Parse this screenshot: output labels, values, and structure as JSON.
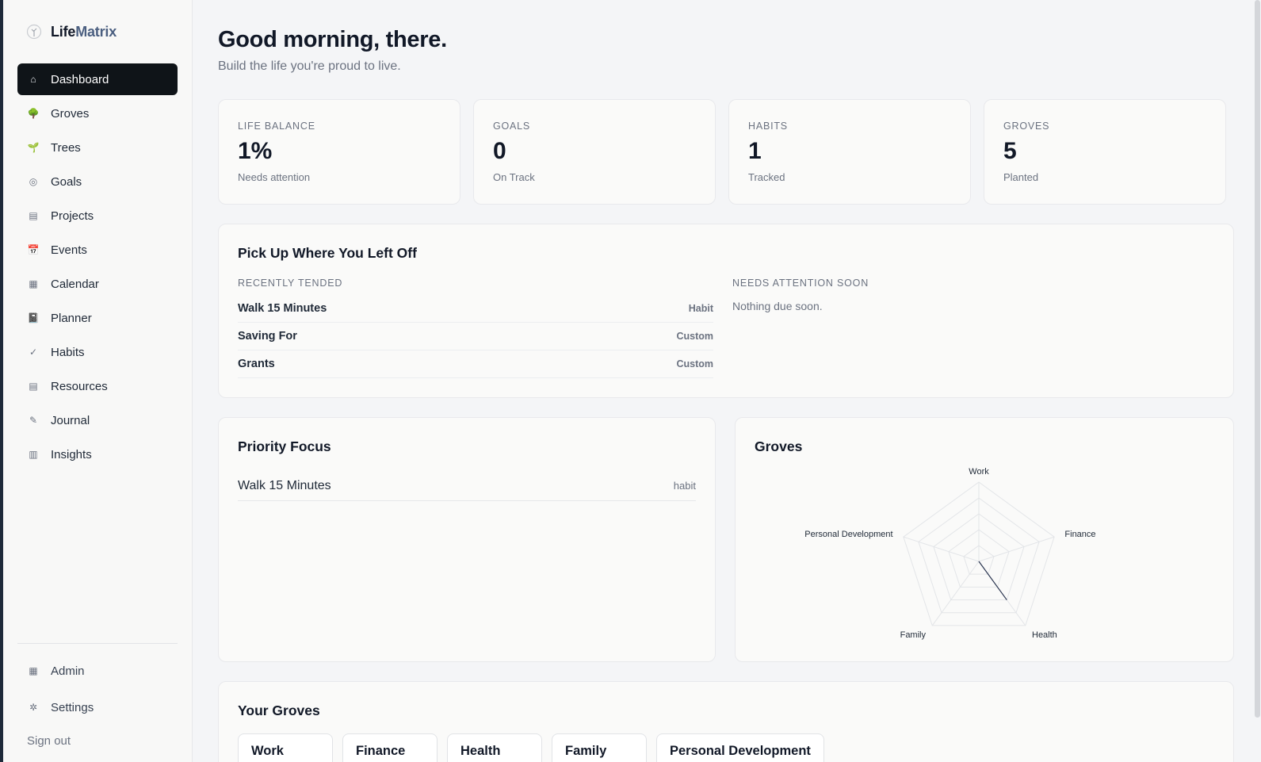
{
  "brand": {
    "part1": "Life",
    "part2": "Matrix"
  },
  "nav": [
    {
      "label": "Dashboard",
      "icon": "⌂",
      "name": "home-icon"
    },
    {
      "label": "Groves",
      "icon": "🌳",
      "name": "tree-icon"
    },
    {
      "label": "Trees",
      "icon": "🌱",
      "name": "seedling-icon"
    },
    {
      "label": "Goals",
      "icon": "◎",
      "name": "target-icon"
    },
    {
      "label": "Projects",
      "icon": "▤",
      "name": "folder-icon"
    },
    {
      "label": "Events",
      "icon": "📅",
      "name": "calendar-date-icon"
    },
    {
      "label": "Calendar",
      "icon": "▦",
      "name": "calendar-icon"
    },
    {
      "label": "Planner",
      "icon": "📓",
      "name": "notebook-icon"
    },
    {
      "label": "Habits",
      "icon": "✓",
      "name": "check-icon"
    },
    {
      "label": "Resources",
      "icon": "▤",
      "name": "resources-icon"
    },
    {
      "label": "Journal",
      "icon": "✎",
      "name": "pencil-icon"
    },
    {
      "label": "Insights",
      "icon": "▥",
      "name": "chart-icon"
    }
  ],
  "bottom_nav": [
    {
      "label": "Admin",
      "icon": "▦",
      "name": "admin-icon"
    },
    {
      "label": "Settings",
      "icon": "✲",
      "name": "gear-icon"
    }
  ],
  "signout": "Sign out",
  "header": {
    "greeting": "Good morning, there.",
    "subtitle": "Build the life you're proud to live."
  },
  "stats": [
    {
      "label": "LIFE BALANCE",
      "value": "1%",
      "note": "Needs attention"
    },
    {
      "label": "GOALS",
      "value": "0",
      "note": "On Track"
    },
    {
      "label": "HABITS",
      "value": "1",
      "note": "Tracked"
    },
    {
      "label": "GROVES",
      "value": "5",
      "note": "Planted"
    }
  ],
  "pickup": {
    "title": "Pick Up Where You Left Off",
    "recent_head": "RECENTLY TENDED",
    "recent": [
      {
        "name": "Walk 15 Minutes",
        "tag": "Habit"
      },
      {
        "name": "Saving For",
        "tag": "Custom"
      },
      {
        "name": "Grants",
        "tag": "Custom"
      }
    ],
    "attention_head": "NEEDS ATTENTION SOON",
    "attention_empty": "Nothing due soon."
  },
  "focus": {
    "title": "Priority Focus",
    "item": "Walk 15 Minutes",
    "kind": "habit"
  },
  "groves_chart": {
    "title": "Groves",
    "chart_data": {
      "type": "radar",
      "categories": [
        "Work",
        "Finance",
        "Health",
        "Family",
        "Personal Development"
      ],
      "values": [
        0,
        0,
        0.6,
        0,
        0
      ],
      "rlim": [
        0,
        1
      ],
      "grid": true,
      "accent": "#2a3550"
    }
  },
  "your_groves": {
    "title": "Your Groves",
    "items": [
      "Work",
      "Finance",
      "Health",
      "Family",
      "Personal Development"
    ]
  }
}
